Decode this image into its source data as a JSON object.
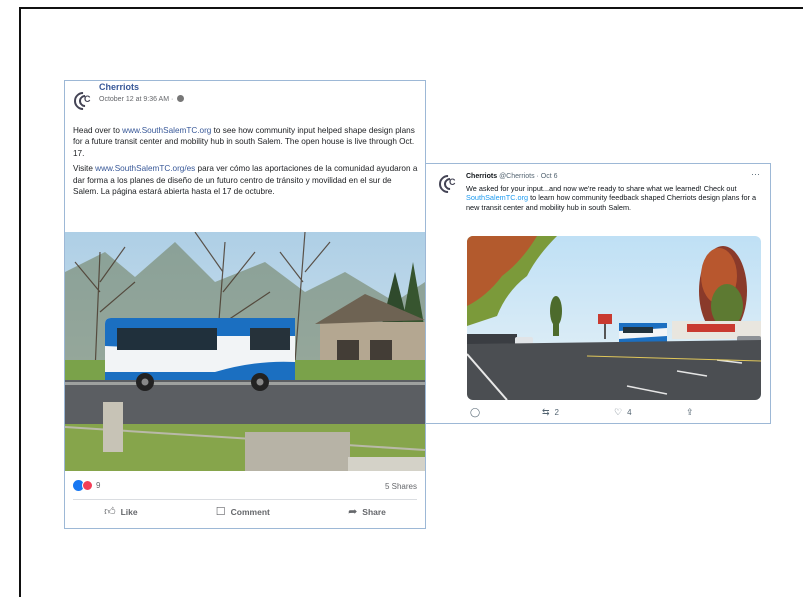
{
  "facebook": {
    "page_name": "Cherriots",
    "timestamp": "October 12 at 9:36 AM ·",
    "paragraph1": {
      "before": "Head over to ",
      "link": "www.SouthSalemTC.org",
      "after": " to see how community input helped shape design plans for a future transit center and mobility hub in south Salem. The open house is live through Oct. 17."
    },
    "paragraph2": {
      "before": "Visite ",
      "link": "www.SouthSalemTC.org/es",
      "after": " para ver cómo las aportaciones de la comunidad ayudaron a dar forma a los planes de diseño de un futuro centro de tránsito y movilidad en el sur de Salem. La página estará abierta hasta el 17 de octubre."
    },
    "reaction_count": "9",
    "shares": "5 Shares",
    "actions": {
      "like": "Like",
      "comment": "Comment",
      "share": "Share"
    }
  },
  "tweet": {
    "name": "Cherriots",
    "handle_date": "@Cherriots · Oct 6",
    "more": "···",
    "text_before": "We asked for your input...and now we're ready to share what we learned! Check out ",
    "link": "SouthSalemTC.org",
    "text_after": " to learn how community feedback shaped Cherriots design plans for a new transit center and mobility hub in south Salem.",
    "reply_count": "",
    "retweet_count": "2",
    "like_count": "4",
    "share_count": ""
  },
  "icons": {
    "logo": "cherriots-logo-icon",
    "globe": "globe-icon",
    "like": "thumbs-up-icon",
    "comment": "comment-icon",
    "share": "share-arrow-icon",
    "reply": "reply-icon",
    "retweet": "retweet-icon",
    "heart": "heart-icon",
    "upload": "upload-icon"
  },
  "colors": {
    "fb_link": "#385898",
    "tw_link": "#1d9bf0",
    "like_blue": "#1877f2",
    "love_red": "#f33e58",
    "bus_blue": "#1b6fc1"
  }
}
